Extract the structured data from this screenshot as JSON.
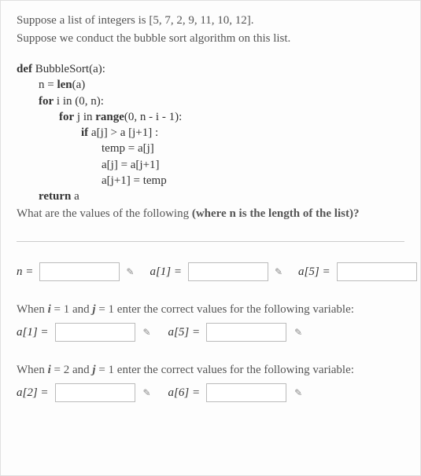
{
  "intro": {
    "line1_prefix": "Suppose a list of integers is ",
    "list_literal": "[5, 7, 2, 9, 11, 10, 12]",
    "line1_suffix": ".",
    "line2": "Suppose we conduct the bubble sort algorithm on this list."
  },
  "code": {
    "l1_kw": "def",
    "l1_fn": "BubbleSort",
    "l1_rest": "(a):",
    "l2_pre": "n = ",
    "l2_fn": "len",
    "l2_post": "(a)",
    "l3_kw": "for",
    "l3_rest": " i in (0, n):",
    "l4_kw": "for",
    "l4_mid": " j in ",
    "l4_fn": "range",
    "l4_post": "(0, n - i - 1):",
    "l5_kw": "if",
    "l5_rest": " a[j] > a [j+1] :",
    "l6": "temp = a[j]",
    "l7": "a[j] = a[j+1]",
    "l8": "a[j+1] = temp",
    "l9_kw": "return",
    "l9_rest": " a"
  },
  "question": {
    "prefix": "What are the values of the following ",
    "bold": "(where n is the length of the list)?"
  },
  "row1": {
    "lbl_n": "n =",
    "lbl_a1": "a[1] =",
    "lbl_a5": "a[5] ="
  },
  "sec2": {
    "prompt_pre": "When ",
    "i": "i",
    "eq1": " = 1",
    "and": " and ",
    "j": "j",
    "eq2": " = 1",
    "prompt_post": " enter the correct values for the following variable:",
    "lbl_a1": "a[1] =",
    "lbl_a5": "a[5] ="
  },
  "sec3": {
    "prompt_pre": "When ",
    "i": "i",
    "eq1": " = 2",
    "and": " and ",
    "j": "j",
    "eq2": " = 1",
    "prompt_post": " enter the correct values for the following variable:",
    "lbl_a2": "a[2] =",
    "lbl_a6": "a[6] ="
  },
  "icons": {
    "pencil": "✎"
  }
}
